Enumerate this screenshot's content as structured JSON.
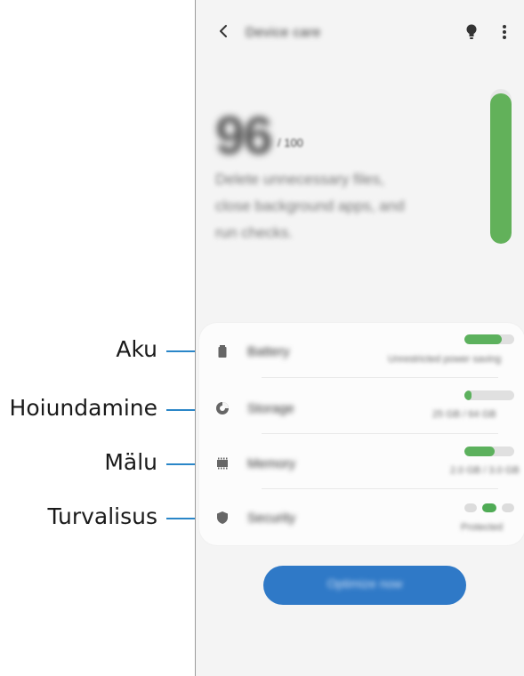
{
  "callouts": {
    "battery": "Aku",
    "storage": "Hoiundamine",
    "memory": "Mälu",
    "security": "Turvalisus"
  },
  "screen": {
    "title": "Device care",
    "score": "96",
    "score_unit": "/ 100",
    "description": [
      "Delete unnecessary files,",
      "close background apps, and",
      "run checks."
    ],
    "score_fill_fraction": 0.97,
    "rows": [
      {
        "label": "Battery",
        "value": "Unrestricted power saving",
        "level": 0.75,
        "icon": "battery-icon"
      },
      {
        "label": "Storage",
        "value": "25 GB / 64 GB",
        "level": 0.15,
        "icon": "storage-icon"
      },
      {
        "label": "Memory",
        "value": "2.0 GB / 3.0 GB",
        "level": 0.6,
        "icon": "memory-icon"
      },
      {
        "label": "Security",
        "value": "Protected",
        "icon": "shield-icon"
      }
    ],
    "optimize_label": "Optimize now",
    "accent": "#62b15a",
    "button_color": "#2f79c7",
    "callout_color": "#2a86c8"
  }
}
